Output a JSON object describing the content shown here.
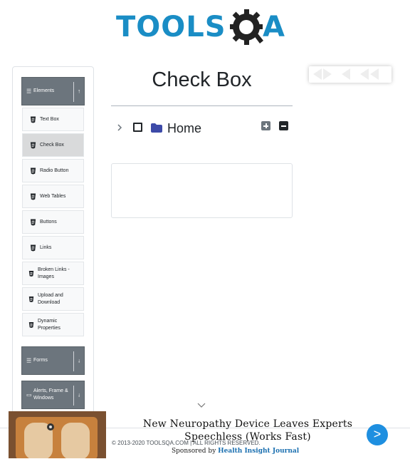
{
  "header": {
    "logo_main": "TOOLS",
    "logo_end": "A",
    "logo_q": "Q"
  },
  "sidebar": {
    "groups": [
      {
        "label": "Elements",
        "icon": "list-icon",
        "state": "expanded"
      },
      {
        "label": "Forms",
        "icon": "list-icon",
        "state": "collapsed"
      },
      {
        "label": "Alerts, Frame & Windows",
        "icon": "window-icon",
        "state": "collapsed"
      }
    ],
    "items": [
      {
        "label": "Text Box"
      },
      {
        "label": "Check Box",
        "active": true
      },
      {
        "label": "Radio Button"
      },
      {
        "label": "Web Tables"
      },
      {
        "label": "Buttons"
      },
      {
        "label": "Links"
      },
      {
        "label": "Broken Links - Images"
      },
      {
        "label": "Upload and Download"
      },
      {
        "label": "Dynamic Properties"
      }
    ]
  },
  "main": {
    "title": "Check Box",
    "tree": {
      "root_label": "Home",
      "checked": false,
      "expanded": false
    }
  },
  "footer": {
    "copyright": "© 2013-2020 TOOLSQA.COM | ALL RIGHTS RESERVED."
  },
  "ad": {
    "headline": "New Neuropathy Device Leaves Experts Speechless (Works Fast)",
    "sponsored_by": "Sponsored by",
    "sponsor_name": "Health Insight Journal",
    "next_label": ">"
  },
  "colors": {
    "accent": "#1a8dc5",
    "sidebar_header": "#6c757d",
    "ad_button": "#1e8fe0"
  }
}
